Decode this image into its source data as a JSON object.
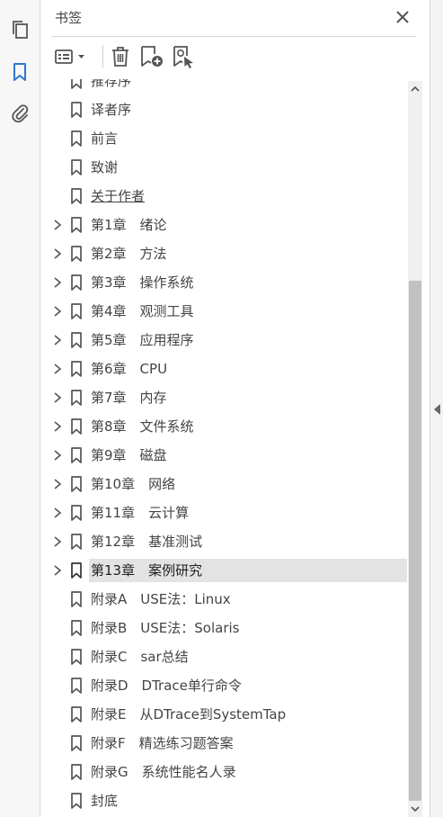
{
  "panel": {
    "title": "书签"
  },
  "rail": {
    "items": [
      {
        "icon": "pages-icon",
        "active": false
      },
      {
        "icon": "bookmark-icon",
        "active": true
      },
      {
        "icon": "attachment-icon",
        "active": false
      }
    ]
  },
  "toolbar": {
    "buttons": [
      "options-menu-icon",
      "delete-bookmark-icon",
      "new-bookmark-icon",
      "find-bookmark-icon"
    ]
  },
  "colors": {
    "accent": "#2b78d1",
    "selected_row": "#e3e3e3",
    "icon": "#555555"
  },
  "bookmarks": [
    {
      "label": "推荐序",
      "expandable": false,
      "partial": true
    },
    {
      "label": "译者序",
      "expandable": false
    },
    {
      "label": "前言",
      "expandable": false
    },
    {
      "label": "致谢",
      "expandable": false
    },
    {
      "label": "关于作者",
      "expandable": false,
      "underline": true
    },
    {
      "label": "第1章　绪论",
      "expandable": true
    },
    {
      "label": "第2章　方法",
      "expandable": true
    },
    {
      "label": "第3章　操作系统",
      "expandable": true
    },
    {
      "label": "第4章　观测工具",
      "expandable": true
    },
    {
      "label": "第5章　应用程序",
      "expandable": true
    },
    {
      "label": "第6章　CPU",
      "expandable": true
    },
    {
      "label": "第7章　内存",
      "expandable": true
    },
    {
      "label": "第8章　文件系统",
      "expandable": true
    },
    {
      "label": "第9章　磁盘",
      "expandable": true
    },
    {
      "label": "第10章　网络",
      "expandable": true
    },
    {
      "label": "第11章　云计算",
      "expandable": true
    },
    {
      "label": "第12章　基准测试",
      "expandable": true
    },
    {
      "label": "第13章　案例研究",
      "expandable": true,
      "selected": true
    },
    {
      "label": "附录A　USE法：Linux",
      "expandable": false
    },
    {
      "label": "附录B　USE法：Solaris",
      "expandable": false
    },
    {
      "label": "附录C　sar总结",
      "expandable": false
    },
    {
      "label": "附录D　DTrace单行命令",
      "expandable": false
    },
    {
      "label": "附录E　从DTrace到SystemTap",
      "expandable": false
    },
    {
      "label": "附录F　精选练习题答案",
      "expandable": false
    },
    {
      "label": "附录G　系统性能名人录",
      "expandable": false
    },
    {
      "label": "封底",
      "expandable": false
    }
  ]
}
